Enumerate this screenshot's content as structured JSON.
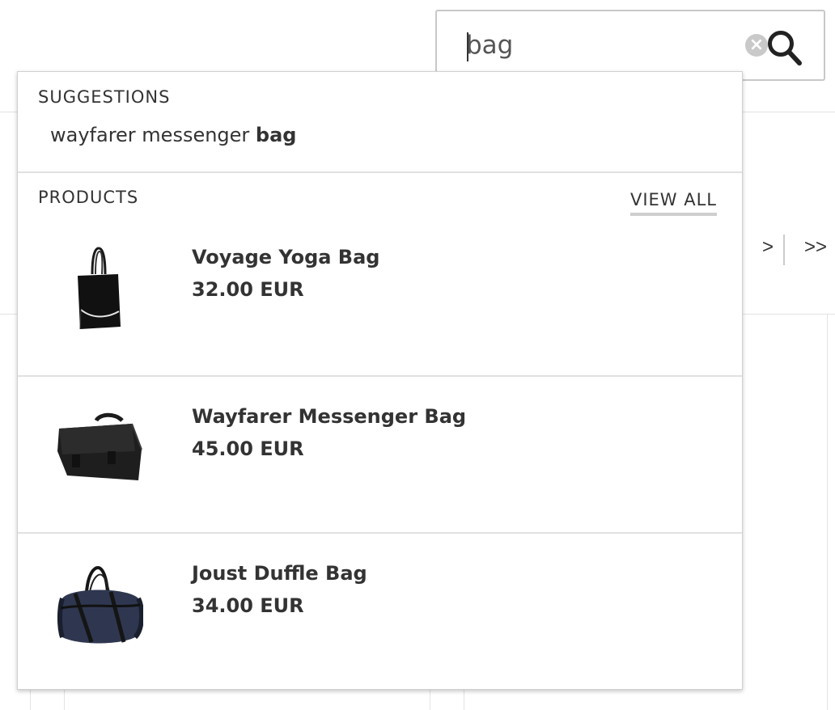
{
  "search": {
    "value": "bag",
    "clear_icon": "×"
  },
  "pager": {
    "next_label": ">",
    "last_label": ">>"
  },
  "dropdown": {
    "suggestions_title": "SUGGESTIONS",
    "suggestions": [
      {
        "prefix": "wayfarer messenger ",
        "match": "bag"
      }
    ],
    "products_title": "PRODUCTS",
    "view_all_label": "VIEW ALL",
    "products": [
      {
        "name": "Voyage Yoga Bag",
        "price": "32.00 EUR",
        "image": "tote-bag-image"
      },
      {
        "name": "Wayfarer Messenger Bag",
        "price": "45.00 EUR",
        "image": "messenger-bag-image"
      },
      {
        "name": "Joust Duffle Bag",
        "price": "34.00 EUR",
        "image": "duffle-bag-image"
      }
    ]
  },
  "colors": {
    "text": "#333333",
    "border": "#c8c8c8",
    "duffle_body": "#2f3750"
  }
}
